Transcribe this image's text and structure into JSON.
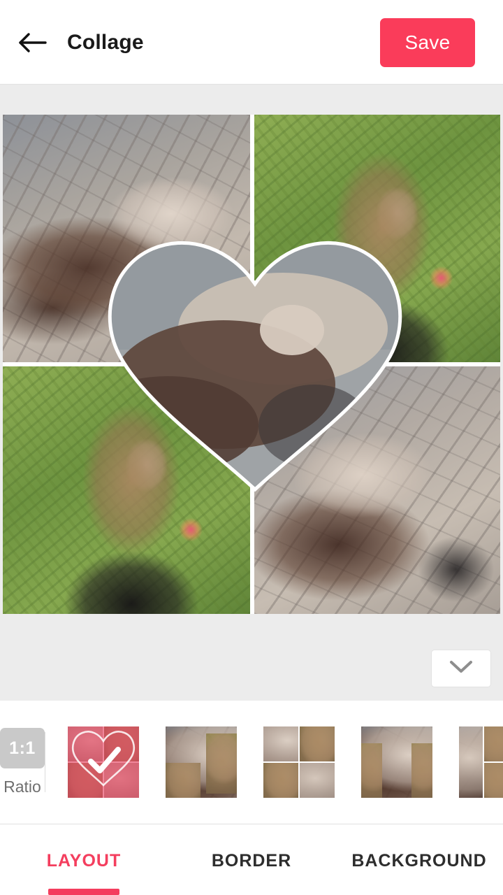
{
  "header": {
    "back_icon": "arrow-left-icon",
    "title": "Collage",
    "save_label": "Save"
  },
  "stage": {
    "background_color": "#ececec",
    "collage": {
      "aspect_ratio": "1:1",
      "grid": "2x2",
      "border_color": "#ffffff",
      "overlay_shape": "heart",
      "overlay_stroke_color": "#ffffff",
      "cells": [
        {
          "position": "top-left",
          "photo": "girl-on-railway-tracks"
        },
        {
          "position": "top-right",
          "photo": "girl-with-flowers-in-garden"
        },
        {
          "position": "bottom-left",
          "photo": "girl-with-flowers-in-garden"
        },
        {
          "position": "bottom-right",
          "photo": "girl-on-railway-tracks"
        }
      ],
      "center_overlay_photo": "girl-on-railway-tracks"
    },
    "expand_icon": "chevron-down-icon"
  },
  "layout_strip": {
    "ratio": {
      "value": "1:1",
      "label": "Ratio",
      "chip_color": "#c9c9c9"
    },
    "thumbnails": [
      {
        "name": "layout-grid-heart",
        "selected": true,
        "shape": "heart",
        "grid": "2x2",
        "check_icon": "check-icon"
      },
      {
        "name": "layout-x-circle",
        "selected": false,
        "shape": "circle",
        "grid": "x-split"
      },
      {
        "name": "layout-grid-circle",
        "selected": false,
        "shape": "circle",
        "grid": "2x2"
      },
      {
        "name": "layout-x-square",
        "selected": false,
        "shape": "square",
        "grid": "x-split"
      },
      {
        "name": "layout-col-grid",
        "selected": false,
        "shape": "none",
        "grid": "1+2x2"
      }
    ],
    "selected_index": 0
  },
  "tabs": {
    "items": [
      {
        "label": "LAYOUT",
        "active": true
      },
      {
        "label": "BORDER",
        "active": false
      },
      {
        "label": "BACKGROUND",
        "active": false
      }
    ],
    "accent_color": "#f43e5e"
  }
}
